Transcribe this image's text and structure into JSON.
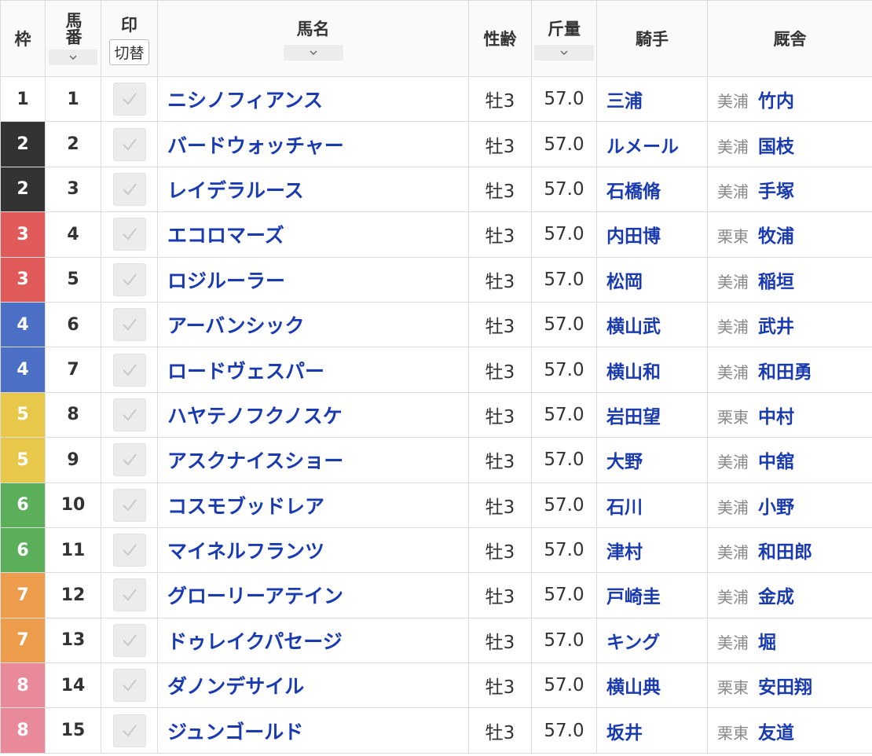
{
  "header": {
    "waku": "枠",
    "umaban": "馬番",
    "mark": "印",
    "mark_toggle": "切替",
    "horse_name": "馬名",
    "sex_age": "性齢",
    "kinryo": "斤量",
    "jockey": "騎手",
    "stable": "厩舎"
  },
  "waku_colors": {
    "1": {
      "bg": "#ffffff",
      "fg": "#333333"
    },
    "2": {
      "bg": "#333333",
      "fg": "#ffffff"
    },
    "3": {
      "bg": "#e05a5a",
      "fg": "#ffffff"
    },
    "4": {
      "bg": "#4a6fc4",
      "fg": "#ffffff"
    },
    "5": {
      "bg": "#e8c84a",
      "fg": "#ffffff"
    },
    "6": {
      "bg": "#5caf5a",
      "fg": "#ffffff"
    },
    "7": {
      "bg": "#ec9c4a",
      "fg": "#ffffff"
    },
    "8": {
      "bg": "#e88a9a",
      "fg": "#ffffff"
    }
  },
  "rows": [
    {
      "waku": "1",
      "umaban": "1",
      "name": "ニシノフィアンス",
      "sex_age": "牡3",
      "kinryo": "57.0",
      "jockey": "三浦",
      "region": "美浦",
      "trainer": "竹内"
    },
    {
      "waku": "2",
      "umaban": "2",
      "name": "バードウォッチャー",
      "sex_age": "牡3",
      "kinryo": "57.0",
      "jockey": "ルメール",
      "region": "美浦",
      "trainer": "国枝"
    },
    {
      "waku": "2",
      "umaban": "3",
      "name": "レイデラルース",
      "sex_age": "牡3",
      "kinryo": "57.0",
      "jockey": "石橋脩",
      "region": "美浦",
      "trainer": "手塚"
    },
    {
      "waku": "3",
      "umaban": "4",
      "name": "エコロマーズ",
      "sex_age": "牡3",
      "kinryo": "57.0",
      "jockey": "内田博",
      "region": "栗東",
      "trainer": "牧浦"
    },
    {
      "waku": "3",
      "umaban": "5",
      "name": "ロジルーラー",
      "sex_age": "牡3",
      "kinryo": "57.0",
      "jockey": "松岡",
      "region": "美浦",
      "trainer": "稲垣"
    },
    {
      "waku": "4",
      "umaban": "6",
      "name": "アーバンシック",
      "sex_age": "牡3",
      "kinryo": "57.0",
      "jockey": "横山武",
      "region": "美浦",
      "trainer": "武井"
    },
    {
      "waku": "4",
      "umaban": "7",
      "name": "ロードヴェスパー",
      "sex_age": "牡3",
      "kinryo": "57.0",
      "jockey": "横山和",
      "region": "美浦",
      "trainer": "和田勇"
    },
    {
      "waku": "5",
      "umaban": "8",
      "name": "ハヤテノフクノスケ",
      "sex_age": "牡3",
      "kinryo": "57.0",
      "jockey": "岩田望",
      "region": "栗東",
      "trainer": "中村"
    },
    {
      "waku": "5",
      "umaban": "9",
      "name": "アスクナイスショー",
      "sex_age": "牡3",
      "kinryo": "57.0",
      "jockey": "大野",
      "region": "美浦",
      "trainer": "中舘"
    },
    {
      "waku": "6",
      "umaban": "10",
      "name": "コスモブッドレア",
      "sex_age": "牡3",
      "kinryo": "57.0",
      "jockey": "石川",
      "region": "美浦",
      "trainer": "小野"
    },
    {
      "waku": "6",
      "umaban": "11",
      "name": "マイネルフランツ",
      "sex_age": "牡3",
      "kinryo": "57.0",
      "jockey": "津村",
      "region": "美浦",
      "trainer": "和田郎"
    },
    {
      "waku": "7",
      "umaban": "12",
      "name": "グローリーアテイン",
      "sex_age": "牡3",
      "kinryo": "57.0",
      "jockey": "戸崎圭",
      "region": "美浦",
      "trainer": "金成"
    },
    {
      "waku": "7",
      "umaban": "13",
      "name": "ドゥレイクパセージ",
      "sex_age": "牡3",
      "kinryo": "57.0",
      "jockey": "キング",
      "region": "美浦",
      "trainer": "堀"
    },
    {
      "waku": "8",
      "umaban": "14",
      "name": "ダノンデサイル",
      "sex_age": "牡3",
      "kinryo": "57.0",
      "jockey": "横山典",
      "region": "栗東",
      "trainer": "安田翔"
    },
    {
      "waku": "8",
      "umaban": "15",
      "name": "ジュンゴールド",
      "sex_age": "牡3",
      "kinryo": "57.0",
      "jockey": "坂井",
      "region": "栗東",
      "trainer": "友道"
    }
  ]
}
